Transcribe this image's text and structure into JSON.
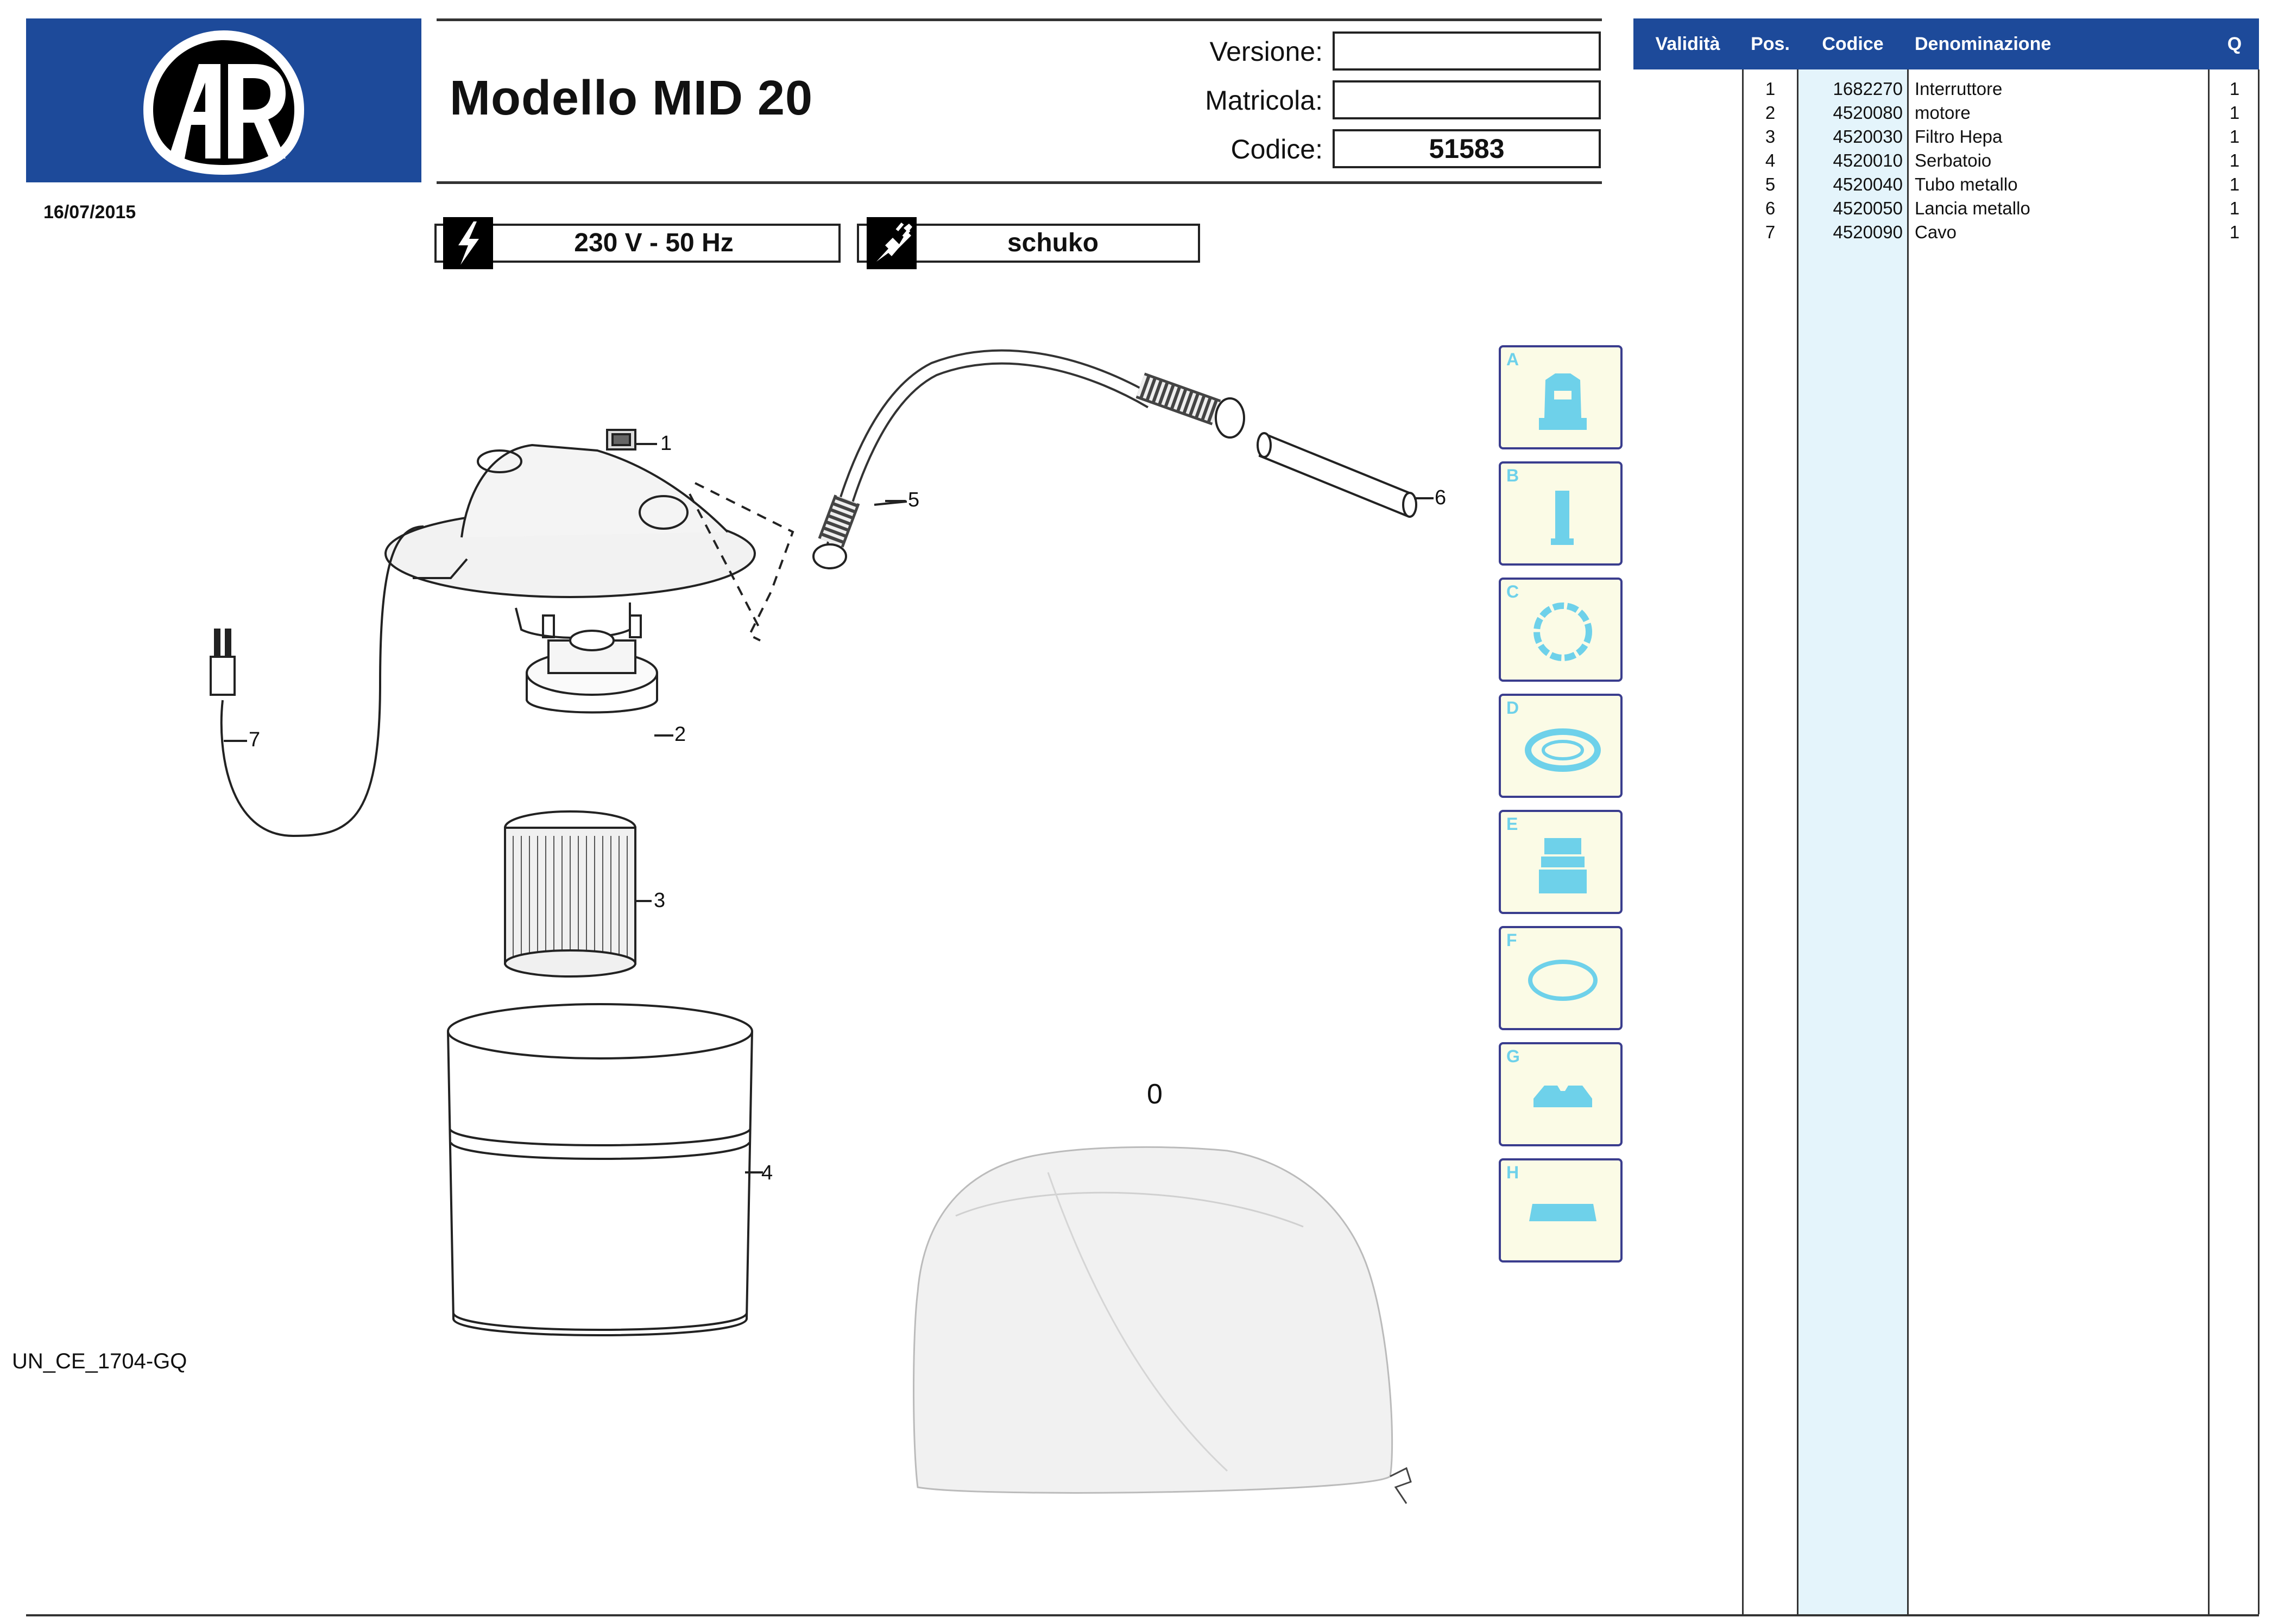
{
  "brand": {
    "logo_text": "AR",
    "color": "#1d4a9a"
  },
  "header": {
    "date": "16/07/2015",
    "model_title": "Modello MID 20",
    "versione_label": "Versione:",
    "versione_value": "",
    "matricola_label": "Matricola:",
    "matricola_value": "",
    "codice_label": "Codice:",
    "codice_value": "51583"
  },
  "specs": {
    "voltage": "230 V - 50 Hz",
    "plug": "schuko"
  },
  "document_code": "UN_CE_1704-GQ",
  "diagram": {
    "callouts": [
      "1",
      "2",
      "3",
      "4",
      "5",
      "6",
      "7"
    ],
    "accessory_label": "0"
  },
  "icon_panels": [
    "A",
    "B",
    "C",
    "D",
    "E",
    "F",
    "G",
    "H"
  ],
  "parts_table": {
    "columns": [
      "Validità",
      "Pos.",
      "Codice",
      "Denominazione",
      "Q"
    ],
    "rows": [
      {
        "pos": "1",
        "codice": "1682270",
        "denominazione": "Interruttore",
        "q": "1"
      },
      {
        "pos": "2",
        "codice": "4520080",
        "denominazione": "motore",
        "q": "1"
      },
      {
        "pos": "3",
        "codice": "4520030",
        "denominazione": "Filtro Hepa",
        "q": "1"
      },
      {
        "pos": "4",
        "codice": "4520010",
        "denominazione": "Serbatoio",
        "q": "1"
      },
      {
        "pos": "5",
        "codice": "4520040",
        "denominazione": "Tubo metallo",
        "q": "1"
      },
      {
        "pos": "6",
        "codice": "4520050",
        "denominazione": "Lancia metallo",
        "q": "1"
      },
      {
        "pos": "7",
        "codice": "4520090",
        "denominazione": "Cavo",
        "q": "1"
      }
    ]
  },
  "colors": {
    "table_header": "#1d4a9a",
    "codice_band": "#e4f4fb",
    "panel_bg": "#fbfbe6",
    "panel_border": "#3a3d8e",
    "panel_icon": "#6ed1ea"
  }
}
